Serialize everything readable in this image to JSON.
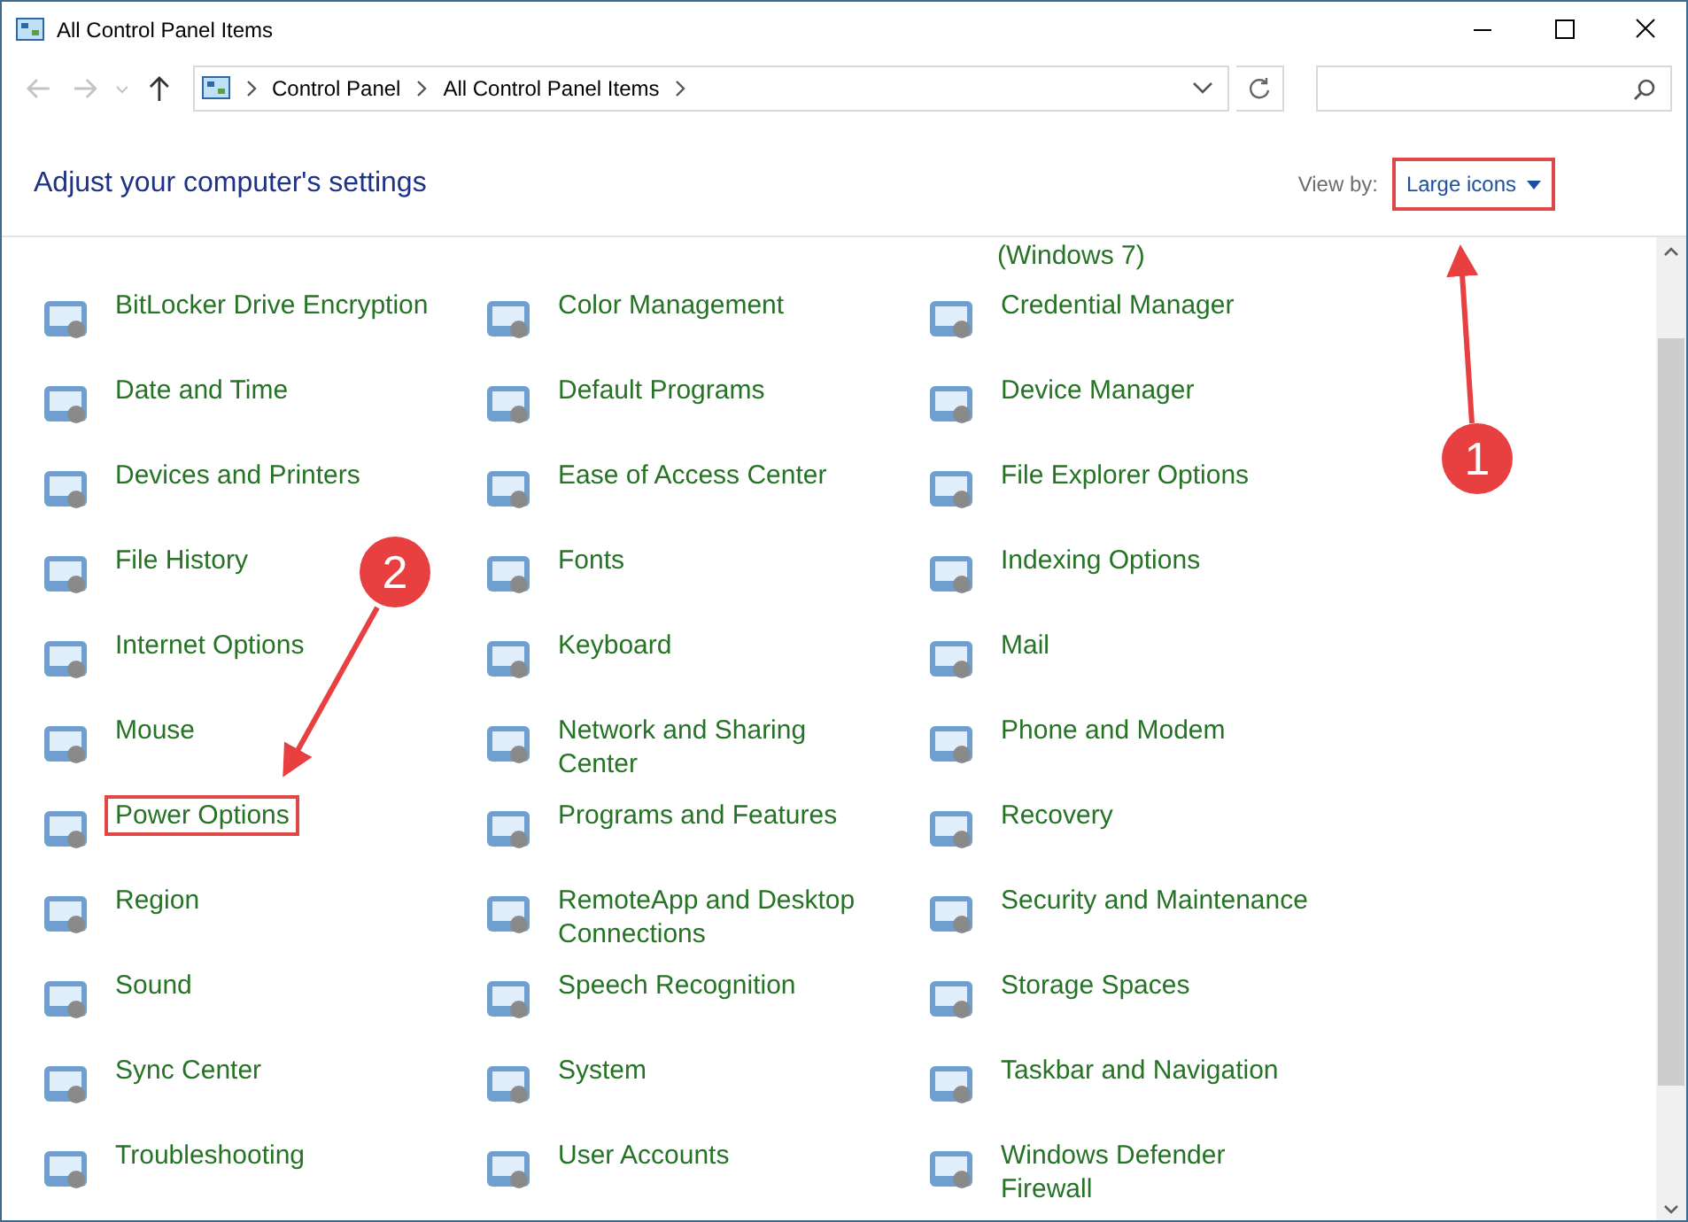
{
  "window": {
    "title": "All Control Panel Items"
  },
  "address_bar": {
    "breadcrumbs": [
      "Control Panel",
      "All Control Panel Items"
    ]
  },
  "heading": "Adjust your computer's settings",
  "view_by": {
    "label": "View by:",
    "value": "Large icons",
    "highlighted": true
  },
  "top_cut_item": {
    "label": "(Windows 7)"
  },
  "items": [
    {
      "label": "BitLocker Drive Encryption",
      "highlighted": false
    },
    {
      "label": "Color Management",
      "highlighted": false
    },
    {
      "label": "Credential Manager",
      "highlighted": false
    },
    {
      "label": "Date and Time",
      "highlighted": false
    },
    {
      "label": "Default Programs",
      "highlighted": false
    },
    {
      "label": "Device Manager",
      "highlighted": false
    },
    {
      "label": "Devices and Printers",
      "highlighted": false
    },
    {
      "label": "Ease of Access Center",
      "highlighted": false
    },
    {
      "label": "File Explorer Options",
      "highlighted": false
    },
    {
      "label": "File History",
      "highlighted": false
    },
    {
      "label": "Fonts",
      "highlighted": false
    },
    {
      "label": "Indexing Options",
      "highlighted": false
    },
    {
      "label": "Internet Options",
      "highlighted": false
    },
    {
      "label": "Keyboard",
      "highlighted": false
    },
    {
      "label": "Mail",
      "highlighted": false
    },
    {
      "label": "Mouse",
      "highlighted": false
    },
    {
      "label": "Network and Sharing Center",
      "highlighted": false
    },
    {
      "label": "Phone and Modem",
      "highlighted": false
    },
    {
      "label": "Power Options",
      "highlighted": true
    },
    {
      "label": "Programs and Features",
      "highlighted": false
    },
    {
      "label": "Recovery",
      "highlighted": false
    },
    {
      "label": "Region",
      "highlighted": false
    },
    {
      "label": "RemoteApp and Desktop Connections",
      "highlighted": false
    },
    {
      "label": "Security and Maintenance",
      "highlighted": false
    },
    {
      "label": "Sound",
      "highlighted": false
    },
    {
      "label": "Speech Recognition",
      "highlighted": false
    },
    {
      "label": "Storage Spaces",
      "highlighted": false
    },
    {
      "label": "Sync Center",
      "highlighted": false
    },
    {
      "label": "System",
      "highlighted": false
    },
    {
      "label": "Taskbar and Navigation",
      "highlighted": false
    },
    {
      "label": "Troubleshooting",
      "highlighted": false
    },
    {
      "label": "User Accounts",
      "highlighted": false
    },
    {
      "label": "Windows Defender Firewall",
      "highlighted": false
    }
  ],
  "annotations": [
    {
      "number": "1"
    },
    {
      "number": "2"
    }
  ]
}
